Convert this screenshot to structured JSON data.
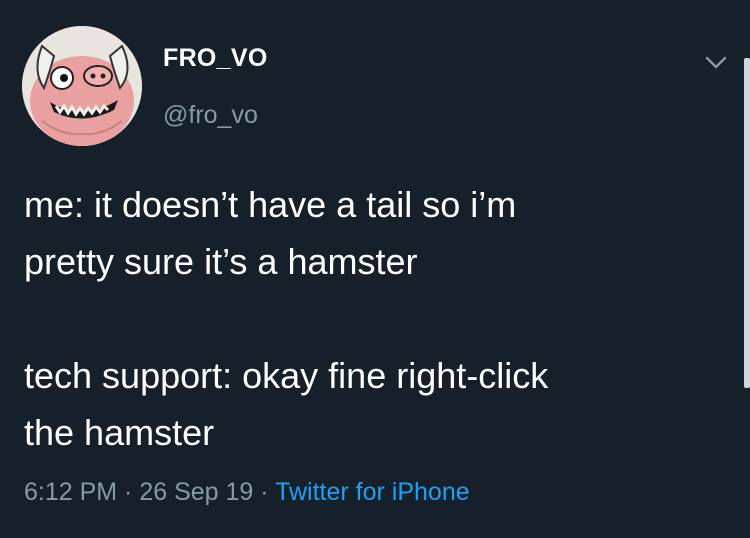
{
  "user": {
    "display_name": "FRO_VO",
    "handle": "@fro_vo"
  },
  "tweet": {
    "line1": "me: it doesn’t have a tail so i’m",
    "line2": "pretty sure it’s a hamster",
    "line3": "tech support: okay fine right-click",
    "line4": "the hamster"
  },
  "meta": {
    "time": "6:12 PM",
    "separator": " · ",
    "date": "26 Sep 19",
    "source": "Twitter for iPhone"
  },
  "colors": {
    "background": "#15202b",
    "secondary_text": "#8899a6",
    "link": "#1da1f2"
  },
  "icons": {
    "avatar": "pig-cartoon-avatar",
    "menu": "chevron-down-icon"
  }
}
